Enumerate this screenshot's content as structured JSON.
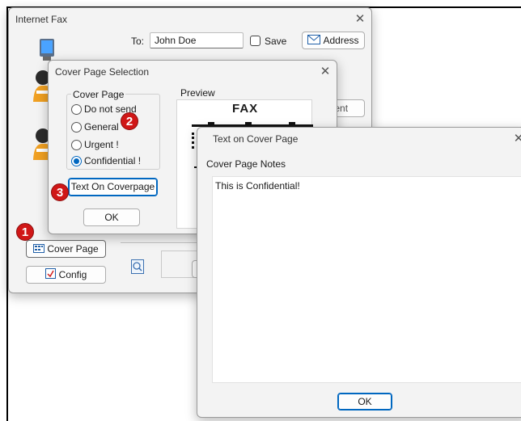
{
  "internet_fax": {
    "title": "Internet Fax",
    "to_label": "To:",
    "to_value": "John Doe",
    "save_label": "Save",
    "address_label": "Address",
    "recipient_partial": "pient",
    "cover_page_button": "Cover Page",
    "config_button": "Config"
  },
  "cover_selection": {
    "title": "Cover Page Selection",
    "group_label": "Cover Page",
    "options": [
      "Do not send",
      "General",
      "Urgent !",
      "Confidential !"
    ],
    "selected": "Confidential !",
    "text_button": "Text On Coverpage",
    "ok_button": "OK",
    "preview_label": "Preview",
    "preview_heading": "FAX"
  },
  "text_on_cover": {
    "title": "Text on Cover Page",
    "notes_label": "Cover Page Notes",
    "notes_value": "This is Confidential!",
    "ok_button": "OK"
  },
  "badges": [
    "1",
    "2",
    "3"
  ],
  "colors": {
    "badge": "#d01717",
    "accent": "#0067c0"
  }
}
